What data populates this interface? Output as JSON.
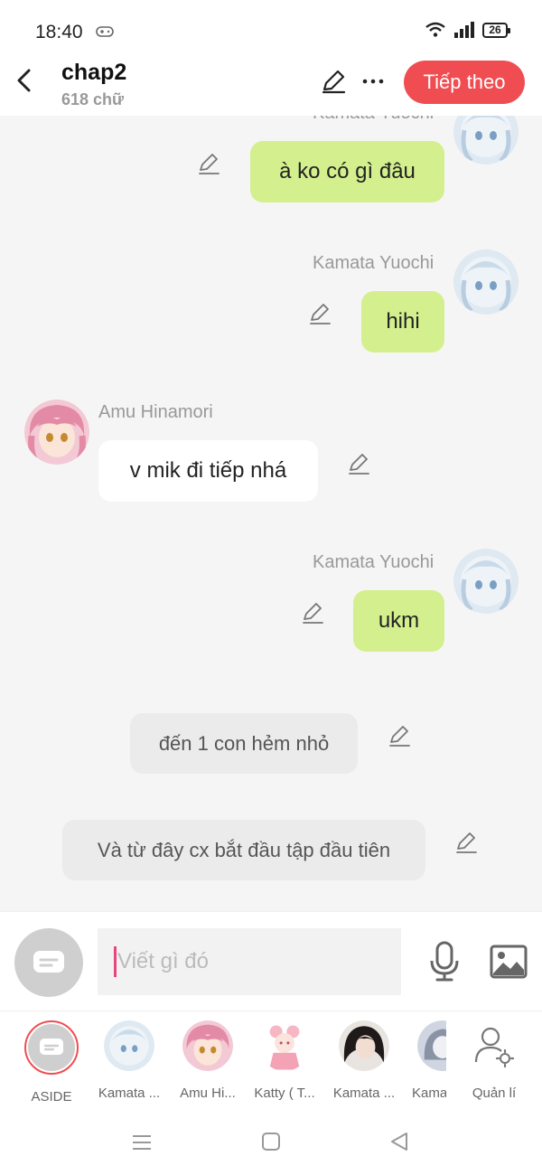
{
  "status_bar": {
    "time": "18:40",
    "battery": "26",
    "icons": [
      "game-controller-icon",
      "wifi-icon",
      "signal-icon",
      "battery-icon"
    ]
  },
  "header": {
    "title": "chap2",
    "word_count": "618 chữ",
    "next_label": "Tiếp theo",
    "accent_color": "#f04d52"
  },
  "messages": [
    {
      "sender": "Kamata Yuochi",
      "text": "à ko có gì đâu",
      "side": "right",
      "style": "green"
    },
    {
      "sender": "Kamata Yuochi",
      "text": "hihi",
      "side": "right",
      "style": "green"
    },
    {
      "sender": "Amu Hinamori",
      "text": "v mik đi tiếp nhá",
      "side": "left",
      "style": "white"
    },
    {
      "sender": "Kamata Yuochi",
      "text": "ukm",
      "side": "right",
      "style": "green"
    },
    {
      "sender": "",
      "text": "đến 1 con hẻm nhỏ",
      "side": "center",
      "style": "narration"
    },
    {
      "sender": "",
      "text": "Và từ đây cx bắt đầu tập đầu tiên",
      "side": "center",
      "style": "narration"
    }
  ],
  "input": {
    "placeholder": "Viết gì đó"
  },
  "characters": [
    {
      "label": "ASIDE",
      "selected": true
    },
    {
      "label": "Kamata ..."
    },
    {
      "label": "Amu Hi..."
    },
    {
      "label": "Katty ( T..."
    },
    {
      "label": "Kamata ..."
    },
    {
      "label": "Kama"
    }
  ],
  "manage_label": "Quản lí",
  "colors": {
    "green_bubble": "#d4f08e",
    "background": "#f5f5f5"
  }
}
